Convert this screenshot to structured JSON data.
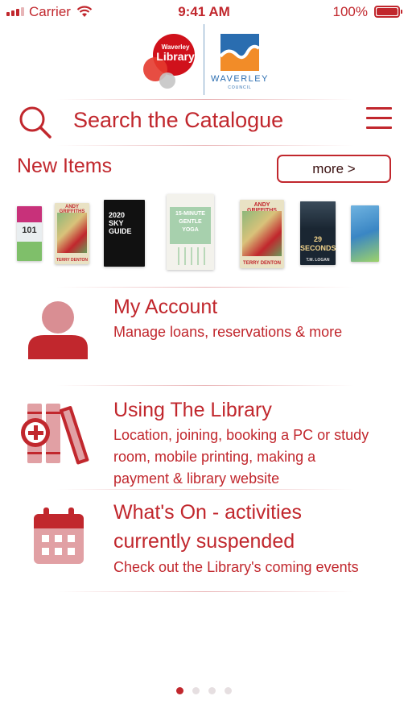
{
  "status_bar": {
    "carrier": "Carrier",
    "time": "9:41 AM",
    "battery": "100%"
  },
  "logo": {
    "library_small": "Waverley",
    "library_big": "Library",
    "council": "WAVERLEY",
    "council_sub": "COUNCIL"
  },
  "search": {
    "placeholder": "Search the Catalogue"
  },
  "new_items": {
    "title": "New Items",
    "more_label": "more >"
  },
  "books": [
    {
      "title": "101",
      "accent": "#c8317a"
    },
    {
      "title": "ANDY GRIFFITHS",
      "author": "TERRY DENTON",
      "accent": "#c1272d"
    },
    {
      "title": "2020 SKY GUIDE",
      "accent": "#111111"
    },
    {
      "title": "15-MINUTE GENTLE YOGA",
      "accent": "#9bc8a0"
    },
    {
      "title": "ANDY GRIFFITHS",
      "author": "TERRY DENTON",
      "accent": "#c1272d"
    },
    {
      "title": "29 SECONDS",
      "author": "T.M. LOGAN",
      "accent": "#1a2632"
    },
    {
      "title": "",
      "accent": "#3a86c4"
    }
  ],
  "account": {
    "title": "My Account",
    "desc": "Manage loans, reservations & more"
  },
  "using": {
    "title": "Using The Library",
    "desc1": "Location, joining, booking a PC or study",
    "desc2": "room, mobile printing, making a",
    "desc3": "payment & library website"
  },
  "whats_on": {
    "title1": "What's On - activities",
    "title2": "currently suspended",
    "desc": "Check out the Library's coming events"
  },
  "pager": {
    "count": 4,
    "active": 0
  },
  "colors": {
    "brand": "#c1272d",
    "council_blue": "#2a6db0",
    "council_orange": "#f28c28"
  }
}
